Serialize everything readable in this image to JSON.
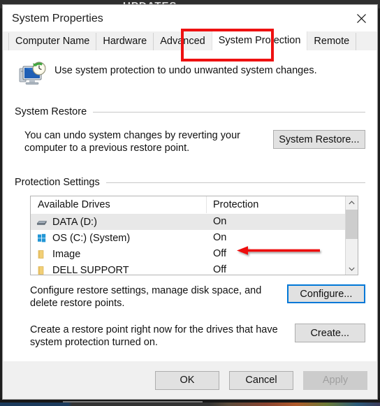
{
  "desktop": {
    "background_text": "UPDATES"
  },
  "window": {
    "title": "System Properties",
    "close_icon": "close-icon"
  },
  "tabs": [
    {
      "label": "Computer Name",
      "selected": false
    },
    {
      "label": "Hardware",
      "selected": false
    },
    {
      "label": "Advanced",
      "selected": false
    },
    {
      "label": "System Protection",
      "selected": true
    },
    {
      "label": "Remote",
      "selected": false
    }
  ],
  "intro": {
    "icon": "system-restore-icon",
    "text": "Use system protection to undo unwanted system changes."
  },
  "system_restore": {
    "group_label": "System Restore",
    "description": "You can undo system changes by reverting your computer to a previous restore point.",
    "button_label": "System Restore..."
  },
  "protection_settings": {
    "group_label": "Protection Settings",
    "columns": [
      "Available Drives",
      "Protection"
    ],
    "rows": [
      {
        "icon": "hard-drive-icon",
        "drive": "DATA (D:)",
        "protection": "On",
        "selected": true
      },
      {
        "icon": "windows-logo-icon",
        "drive": "OS (C:) (System)",
        "protection": "On",
        "selected": false
      },
      {
        "icon": "folder-icon",
        "drive": "Image",
        "protection": "Off",
        "selected": false
      },
      {
        "icon": "folder-icon",
        "drive": "DELL SUPPORT",
        "protection": "Off",
        "selected": false
      }
    ],
    "scrollbar": {
      "up_icon": "chevron-up-icon",
      "down_icon": "chevron-down-icon"
    },
    "configure": {
      "description": "Configure restore settings, manage disk space, and delete restore points.",
      "button_label": "Configure..."
    },
    "create": {
      "description": "Create a restore point right now for the drives that have system protection turned on.",
      "button_label": "Create..."
    }
  },
  "footer": {
    "ok_label": "OK",
    "cancel_label": "Cancel",
    "apply_label": "Apply"
  },
  "annotations": {
    "highlight_color": "#ee1111",
    "tab_highlight_target": "System Protection",
    "arrow_target": "OS (C:) (System) protection value"
  }
}
